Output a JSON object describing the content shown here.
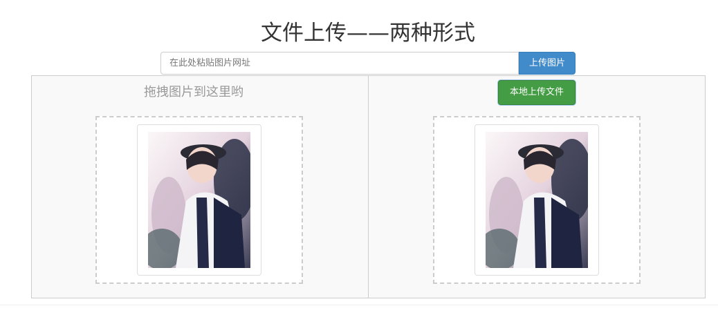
{
  "page": {
    "title": "文件上传——两种形式"
  },
  "url_upload": {
    "placeholder": "在此处粘贴图片网址",
    "button_label": "上传图片"
  },
  "local_upload": {
    "button_label": "本地上传文件"
  },
  "drag_panel": {
    "hint": "拖拽图片到这里哟"
  },
  "colors": {
    "primary_button": "#428bca",
    "success_button": "#449d44",
    "panel_bg": "#f9f9f9"
  }
}
